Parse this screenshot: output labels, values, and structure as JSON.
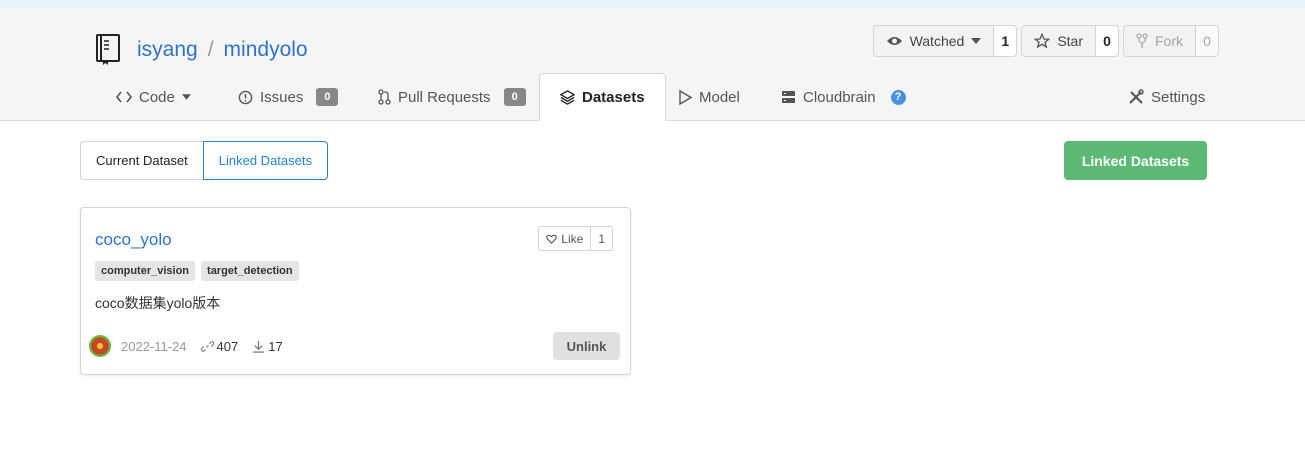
{
  "repo": {
    "owner": "isyang",
    "separator": "/",
    "name": "mindyolo"
  },
  "actions": {
    "watch": {
      "label": "Watched",
      "count": "1"
    },
    "star": {
      "label": "Star",
      "count": "0"
    },
    "fork": {
      "label": "Fork",
      "count": "0"
    }
  },
  "tabs": {
    "code": "Code",
    "issues": {
      "label": "Issues",
      "count": "0"
    },
    "pulls": {
      "label": "Pull Requests",
      "count": "0"
    },
    "datasets": "Datasets",
    "model": "Model",
    "cloudbrain": "Cloudbrain",
    "settings": "Settings"
  },
  "switcher": {
    "current": "Current Dataset",
    "linked": "Linked Datasets"
  },
  "linked_button": "Linked Datasets",
  "dataset": {
    "title": "coco_yolo",
    "like_label": "Like",
    "like_count": "1",
    "tags": [
      "computer_vision",
      "target_detection"
    ],
    "description": "coco数据集yolo版本",
    "date": "2022-11-24",
    "links": "407",
    "downloads": "17",
    "unlink_label": "Unlink"
  },
  "colors": {
    "link": "#2f73c9",
    "accent": "#2185d0",
    "primary_green": "#5bb974"
  }
}
